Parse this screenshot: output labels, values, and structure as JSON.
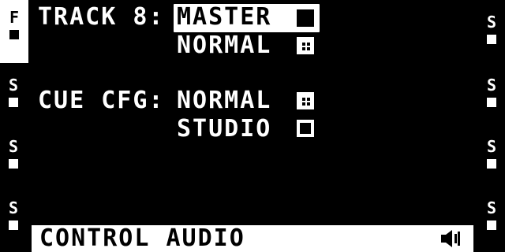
{
  "left_tabs": [
    {
      "glyph": "F",
      "active": true
    },
    {
      "glyph": "S",
      "active": false
    },
    {
      "glyph": "S",
      "active": false
    },
    {
      "glyph": "S",
      "active": false
    }
  ],
  "right_tabs": [
    {
      "glyph": "S"
    },
    {
      "glyph": "S"
    },
    {
      "glyph": "S"
    },
    {
      "glyph": "S"
    }
  ],
  "settings": {
    "track8": {
      "label": "TRACK 8:",
      "options": [
        {
          "label": "MASTER",
          "checked": false,
          "selected": true
        },
        {
          "label": "NORMAL",
          "checked": true,
          "selected": false
        }
      ]
    },
    "cue_cfg": {
      "label": "CUE CFG:",
      "options": [
        {
          "label": "NORMAL",
          "checked": true,
          "selected": false
        },
        {
          "label": "STUDIO",
          "checked": false,
          "selected": false
        }
      ]
    }
  },
  "footer": {
    "title": "CONTROL AUDIO",
    "icon": "speaker-icon"
  }
}
